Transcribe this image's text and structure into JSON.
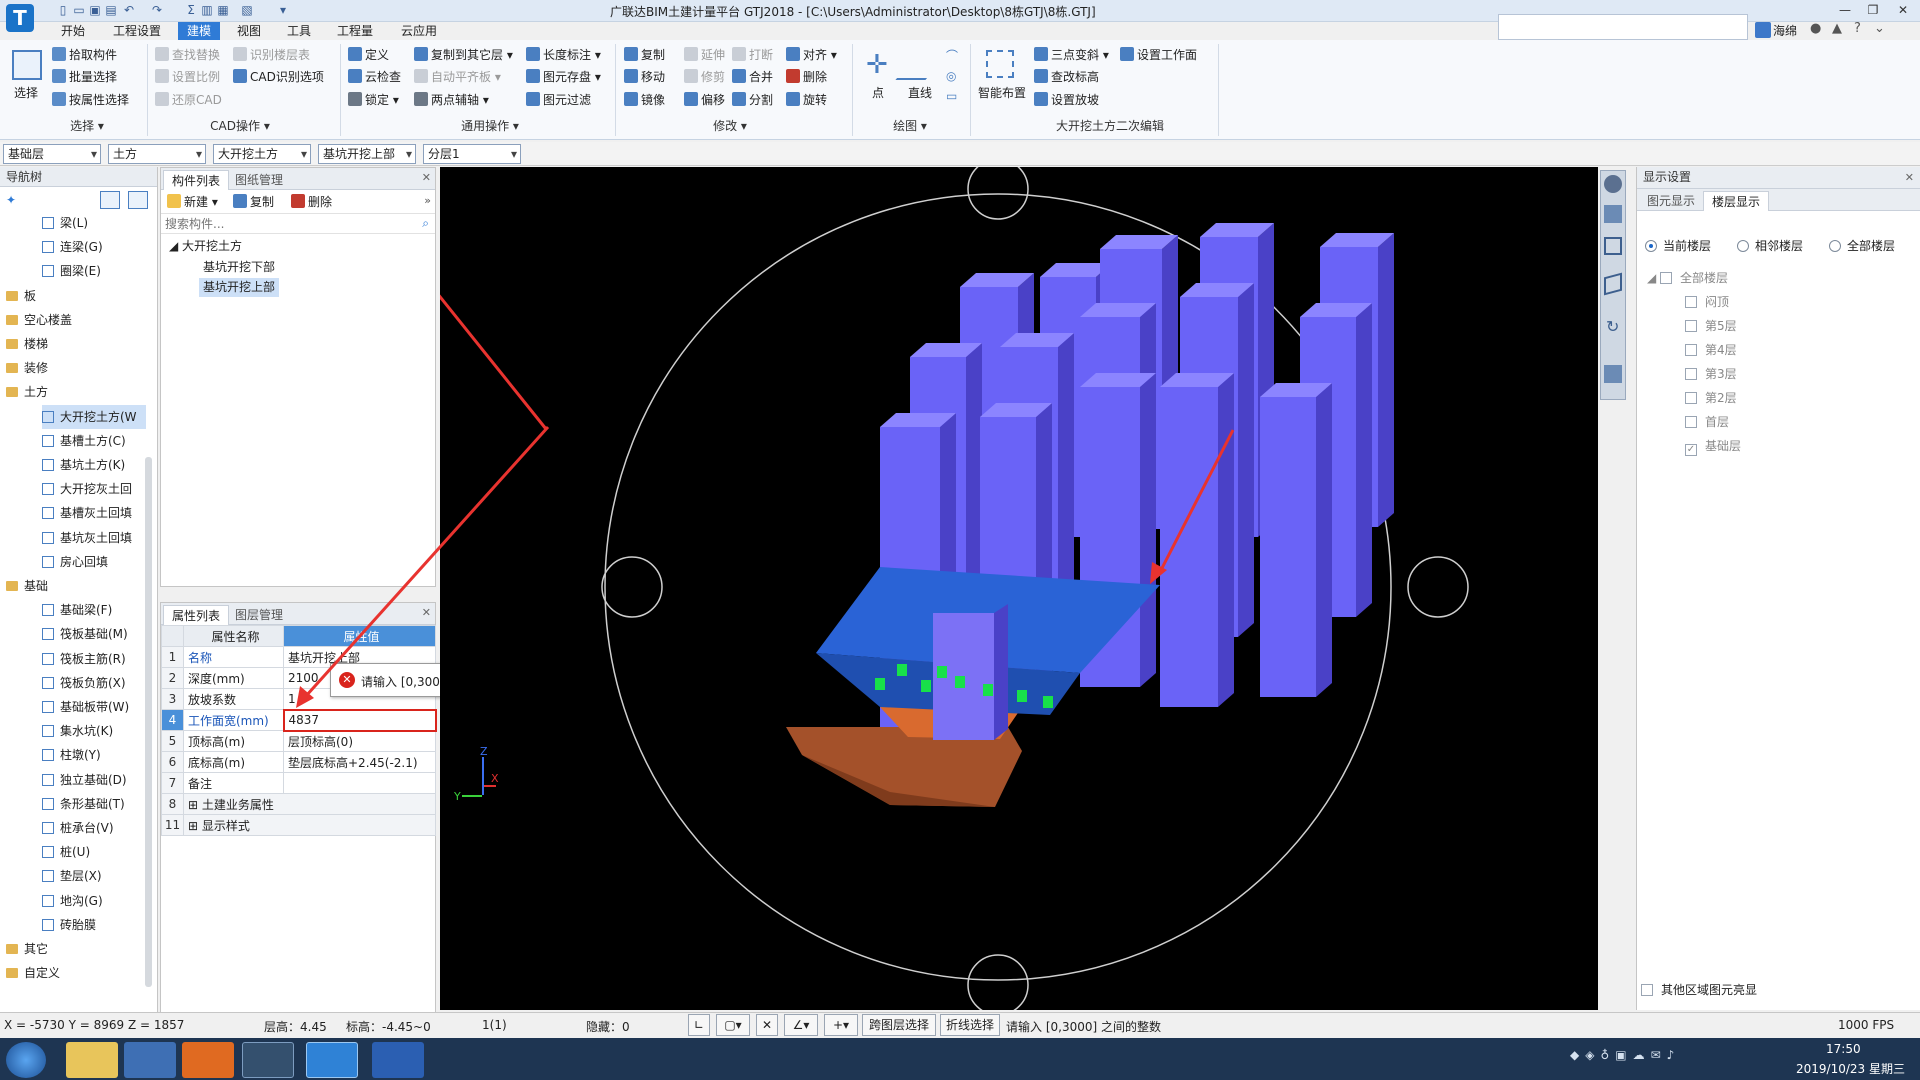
{
  "window": {
    "title": "广联达BIM土建计量平台 GTJ2018 - [C:\\Users\\Administrator\\Desktop\\8栋GTJ\\8栋.GTJ]",
    "user": "海绵",
    "logo_letter": "T"
  },
  "menu": [
    "开始",
    "工程设置",
    "建模",
    "视图",
    "工具",
    "工程量",
    "云应用"
  ],
  "menu_active": "建模",
  "ribbon": {
    "select_label": "选择",
    "select_group": [
      "拾取构件",
      "批量选择",
      "按属性选择"
    ],
    "select_group_label": "选择",
    "cad_group": [
      "查找替换",
      "识别楼层表",
      "设置比例",
      "CAD识别选项",
      "还原CAD"
    ],
    "cad_group_label": "CAD操作",
    "common_group": [
      "定义",
      "复制到其它层",
      "长度标注",
      "云检查",
      "自动平齐板",
      "图元存盘",
      "锁定",
      "两点辅轴",
      "图元过滤"
    ],
    "common_group_label": "通用操作",
    "modify_group": [
      "复制",
      "延伸",
      "打断",
      "对齐",
      "移动",
      "修剪",
      "合并",
      "删除",
      "镜像",
      "偏移",
      "分割",
      "旋转"
    ],
    "modify_group_label": "修改",
    "draw_group": [
      "点",
      "直线"
    ],
    "draw_group_label": "绘图",
    "smart_layout": "智能布置",
    "excavation_group": [
      "三点变斜",
      "设置工作面",
      "查改标高",
      "设置放坡"
    ],
    "excavation_group_label": "大开挖土方二次编辑"
  },
  "selectors": [
    "基础层",
    "土方",
    "大开挖土方",
    "基坑开挖上部",
    "分层1"
  ],
  "nav": {
    "title": "导航树",
    "items": [
      {
        "label": "梁(L)",
        "level": 2
      },
      {
        "label": "连梁(G)",
        "level": 2
      },
      {
        "label": "圈梁(E)",
        "level": 2
      },
      {
        "label": "板",
        "level": 1
      },
      {
        "label": "空心楼盖",
        "level": 1
      },
      {
        "label": "楼梯",
        "level": 1
      },
      {
        "label": "装修",
        "level": 1
      },
      {
        "label": "土方",
        "level": 1
      },
      {
        "label": "大开挖土方(W",
        "level": 2,
        "selected": true
      },
      {
        "label": "基槽土方(C)",
        "level": 2
      },
      {
        "label": "基坑土方(K)",
        "level": 2
      },
      {
        "label": "大开挖灰土回",
        "level": 2
      },
      {
        "label": "基槽灰土回填",
        "level": 2
      },
      {
        "label": "基坑灰土回填",
        "level": 2
      },
      {
        "label": "房心回填",
        "level": 2
      },
      {
        "label": "基础",
        "level": 1
      },
      {
        "label": "基础梁(F)",
        "level": 2
      },
      {
        "label": "筏板基础(M)",
        "level": 2
      },
      {
        "label": "筏板主筋(R)",
        "level": 2
      },
      {
        "label": "筏板负筋(X)",
        "level": 2
      },
      {
        "label": "基础板带(W)",
        "level": 2
      },
      {
        "label": "集水坑(K)",
        "level": 2
      },
      {
        "label": "柱墩(Y)",
        "level": 2
      },
      {
        "label": "独立基础(D)",
        "level": 2
      },
      {
        "label": "条形基础(T)",
        "level": 2
      },
      {
        "label": "桩承台(V)",
        "level": 2
      },
      {
        "label": "桩(U)",
        "level": 2
      },
      {
        "label": "垫层(X)",
        "level": 2
      },
      {
        "label": "地沟(G)",
        "level": 2
      },
      {
        "label": "砖胎膜",
        "level": 2
      },
      {
        "label": "其它",
        "level": 1
      },
      {
        "label": "自定义",
        "level": 1
      }
    ]
  },
  "components": {
    "tabs": [
      "构件列表",
      "图纸管理"
    ],
    "toolbar": [
      "新建",
      "复制",
      "删除"
    ],
    "search_placeholder": "搜索构件...",
    "tree_root": "大开挖土方",
    "tree_items": [
      "基坑开挖下部",
      "基坑开挖上部"
    ]
  },
  "properties": {
    "tabs": [
      "属性列表",
      "图层管理"
    ],
    "header_name": "属性名称",
    "header_value": "属性值",
    "rows": [
      {
        "no": "1",
        "name": "名称",
        "value": "基坑开挖上部"
      },
      {
        "no": "2",
        "name": "深度(mm)",
        "value": "2100"
      },
      {
        "no": "3",
        "name": "放坡系数",
        "value": "1"
      },
      {
        "no": "4",
        "name": "工作面宽(mm)",
        "value": "4837"
      },
      {
        "no": "5",
        "name": "顶标高(m)",
        "value": "层顶标高(0)"
      },
      {
        "no": "6",
        "name": "底标高(m)",
        "value": "垫层底标高+2.45(-2.1)"
      },
      {
        "no": "7",
        "name": "备注",
        "value": ""
      },
      {
        "no": "8",
        "name": "土建业务属性",
        "value": ""
      },
      {
        "no": "11",
        "name": "显示样式",
        "value": ""
      }
    ],
    "error_tooltip": "请输入 [0,3000] 之间的整数"
  },
  "display": {
    "title": "显示设置",
    "tabs": [
      "图元显示",
      "楼层显示"
    ],
    "radios": [
      "当前楼层",
      "相邻楼层",
      "全部楼层"
    ],
    "floors_root": "全部楼层",
    "floors": [
      {
        "label": "闷顶",
        "checked": false
      },
      {
        "label": "第5层",
        "checked": false
      },
      {
        "label": "第4层",
        "checked": false
      },
      {
        "label": "第3层",
        "checked": false
      },
      {
        "label": "第2层",
        "checked": false
      },
      {
        "label": "首层",
        "checked": false
      },
      {
        "label": "基础层",
        "checked": true
      }
    ],
    "other_highlight": "其他区域图元亮显"
  },
  "status": {
    "coords": "X = -5730 Y = 8969 Z = 1857",
    "floor_height": "层高：4.45",
    "elevation": "标高：-4.45~0",
    "count": "1(1)",
    "hidden": "隐藏：0",
    "cross_layer": "跨图层选择",
    "polyline": "折线选择",
    "message": "请输入 [0,3000] 之间的整数",
    "fps": "1000 FPS"
  },
  "taskbar": {
    "time": "17:50",
    "date": "2019/10/23 星期三"
  },
  "axis_labels": {
    "x": "X",
    "y": "Y",
    "z": "Z"
  },
  "colors": {
    "accent": "#2f7bd6",
    "column": "#6a63f7",
    "pit_top": "#2a63d6",
    "pit_bottom": "#a4512a",
    "arrow": "#e8332f",
    "error": "#d9241c"
  }
}
